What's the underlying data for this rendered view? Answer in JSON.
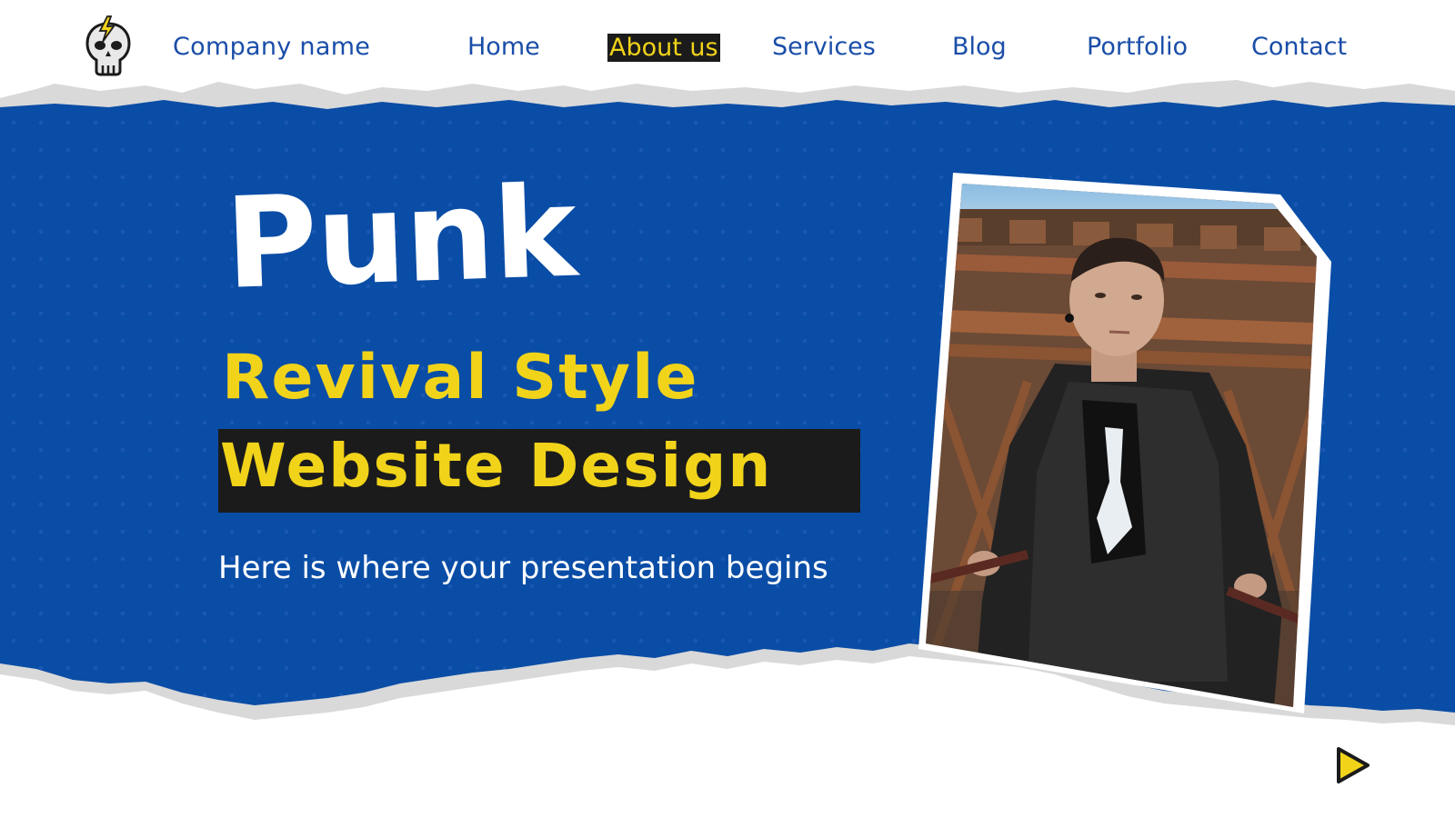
{
  "header": {
    "company_name": "Company name",
    "logo_icon": "skull-lightning-icon",
    "nav": [
      {
        "label": "Home",
        "active": false
      },
      {
        "label": "About us",
        "active": true
      },
      {
        "label": "Services",
        "active": false
      },
      {
        "label": "Blog",
        "active": false
      },
      {
        "label": "Portfolio",
        "active": false
      },
      {
        "label": "Contact",
        "active": false
      }
    ]
  },
  "hero": {
    "title": "Punk",
    "subtitle_line1": "Revival Style",
    "subtitle_line2": "Website Design",
    "tagline": "Here is where your presentation begins"
  },
  "photo": {
    "subject_icon": "person-photo"
  },
  "controls": {
    "next_icon": "play-triangle-icon"
  },
  "colors": {
    "primary_blue": "#0a4da6",
    "accent_yellow": "#f1d31a",
    "dark": "#1b1b1b",
    "white": "#ffffff",
    "torn_gray": "#d9d9d9",
    "nav_blue": "#1a4ea8"
  }
}
